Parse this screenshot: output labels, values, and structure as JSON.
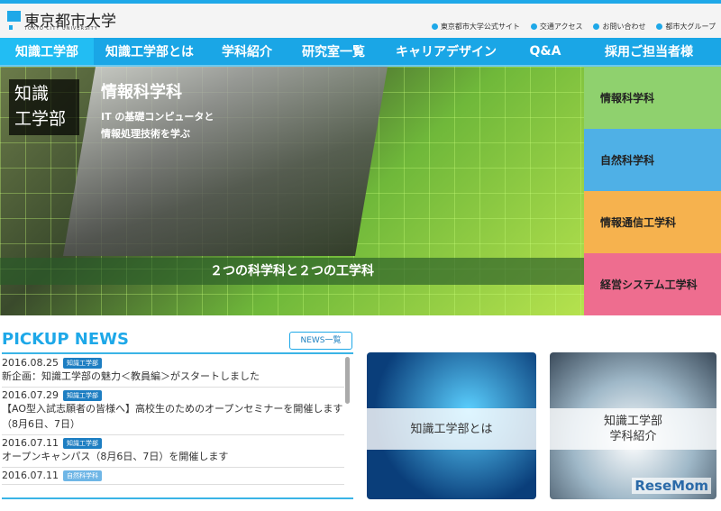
{
  "header": {
    "logo_jp": "東京都市大学",
    "logo_en": "TOKYO CITY UNIVERSITY",
    "util_links": [
      "東京都市大学公式サイト",
      "交通アクセス",
      "お問い合わせ",
      "都市大グループ"
    ]
  },
  "nav": [
    "知識工学部",
    "知識工学部とは",
    "学科紹介",
    "研究室一覧",
    "キャリアデザイン",
    "Q&A",
    "採用ご担当者様"
  ],
  "hero": {
    "badge_line1": "知識",
    "badge_line2": "工学部",
    "title": "情報科学科",
    "sub_line1": "IT の基礎コンピュータと",
    "sub_line2": "情報処理技術を学ぶ",
    "band": "２つの科学科と２つの工学科"
  },
  "departments": [
    {
      "label": "情報科学科",
      "color": "#8fd16e"
    },
    {
      "label": "自然科学科",
      "color": "#4fb0e6"
    },
    {
      "label": "情報通信工学科",
      "color": "#f6b24e"
    },
    {
      "label": "経営システム工学科",
      "color": "#ee6d8f"
    }
  ],
  "news": {
    "title": "PICKUP NEWS",
    "button": "NEWS一覧",
    "items": [
      {
        "date": "2016.08.25",
        "tag": "知識工学部",
        "text": "新企画：知識工学部の魅力＜教員編＞がスタートしました"
      },
      {
        "date": "2016.07.29",
        "tag": "知識工学部",
        "text": "【AO型入試志願者の皆様へ】高校生のためのオープンセミナーを開催します（8月6日、7日）"
      },
      {
        "date": "2016.07.11",
        "tag": "知識工学部",
        "text": "オープンキャンパス（8月6日、7日）を開催します"
      },
      {
        "date": "2016.07.11",
        "tag": "自然科学科",
        "text": ""
      }
    ]
  },
  "cards": [
    {
      "label": "知識工学部とは"
    },
    {
      "line1": "知識工学部",
      "line2": "学科紹介"
    }
  ],
  "watermark": "ReseMom"
}
